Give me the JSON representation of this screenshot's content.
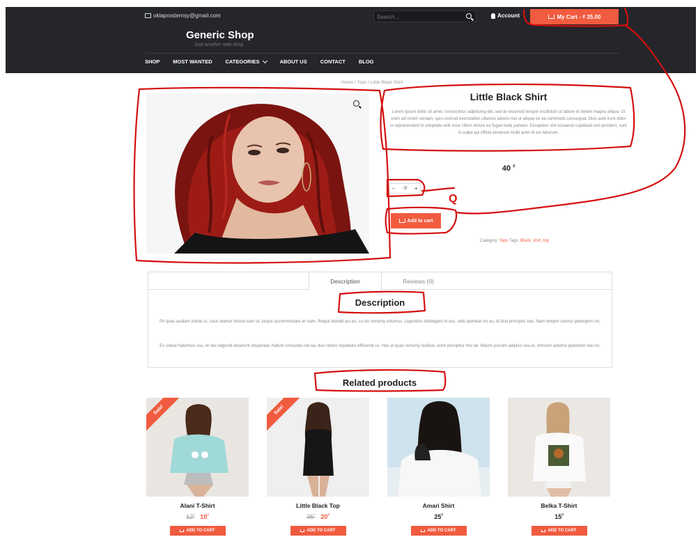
{
  "colors": {
    "accent": "#f15b3f",
    "header_bg": "#24262b",
    "annotation": "#d40f0f"
  },
  "topbar": {
    "email": "oklaprosternsy@gmail.com",
    "search_placeholder": "Search...",
    "account_label": "Account",
    "cart_label": "My Cart - ₫ 35.00"
  },
  "brand": {
    "title": "Generic Shop",
    "tagline": "Just another web shop"
  },
  "nav": {
    "items": [
      "SHOP",
      "MOST WANTED",
      "CATEGORIES",
      "ABOUT US",
      "CONTACT",
      "BLOG"
    ]
  },
  "breadcrumb": "Home / Tops / Little Black Shirt",
  "product": {
    "title": "Little Black Shirt",
    "description": "Lorem ipsum dolor sit amet, consectetur adipiscing elit, sed do eiusmod tempor incididunt ut labore et dolore magna aliqua. Ut enim ad minim veniam, quis nostrud exercitation ullamco laboris nisi ut aliquip ex ea commodo consequat. Duis aute irure dolor in reprehenderit in voluptate velit esse cillum dolore eu fugiat nulla pariatur. Excepteur sint occaecat cupidatat non proident, sunt in culpa qui officia deserunt mollit anim id est laborum.",
    "price": "40",
    "currency": "₫",
    "qty_minus": "−",
    "qty_value": "-9",
    "qty_plus": "+",
    "add_to_cart": "Add to cart",
    "category_label": "Category:",
    "category": "Tops",
    "tags_label": "Tags:",
    "tags": "Black, shirt, top"
  },
  "tabs": {
    "items": [
      "Description",
      "Reviews (0)"
    ],
    "heading": "Description",
    "paragraph1": "Pri quas audiam virtute ut, case utamur fuisset eam ut, iisque accommodare an eam. Reque blandit qui eu, cu vix nonumy volumus. Legendos intellegam id usu, vide oporteat vix eu, id illud principes has. Nam tempor utamur gubergren no.",
    "paragraph2": "Ex soleat habemus usu, te nec eligendi deserunt vituperata. Natum consulatu vel ea, duo cetero repudiare efficiendi cu. Has at quas nonumy facilisis, enim percipitur mei ad. Mazim possim adipisci sea ei, omnium aeterno platonem mei no."
  },
  "related": {
    "title": "Related products",
    "products": [
      {
        "name": "Alani T-Shirt",
        "old_price": "12",
        "price": "10",
        "sale": "Sale!",
        "button": "ADD TO CART"
      },
      {
        "name": "Little Black Top",
        "old_price": "35",
        "price": "20",
        "sale": "Sale!",
        "button": "ADD TO CART"
      },
      {
        "name": "Amari Shirt",
        "price": "25",
        "button": "ADD TO CART"
      },
      {
        "name": "Belka T-Shirt",
        "price": "15",
        "button": "ADD TO CART"
      }
    ]
  },
  "annotation_label": "Q"
}
